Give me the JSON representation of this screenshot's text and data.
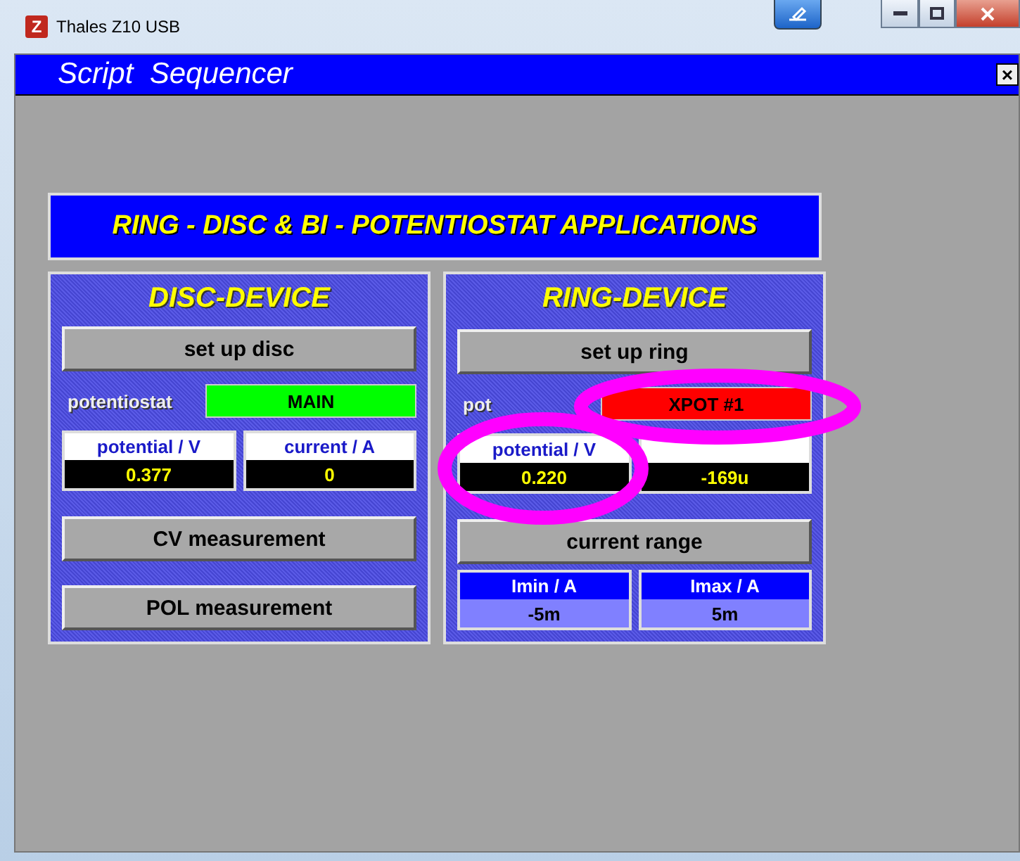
{
  "window": {
    "title": "Thales Z10 USB",
    "app_icon": "Z"
  },
  "dialog": {
    "title": "Script  Sequencer",
    "close": "×"
  },
  "banner": "RING - DISC & BI - POTENTIOSTAT APPLICATIONS",
  "panels": [
    {
      "title": "DISC-DEVICE",
      "setup_button": "set up disc",
      "potentiostat_label": "potentiostat",
      "potentiostat": {
        "value": "MAIN",
        "color": "#00ff00"
      },
      "readouts": [
        {
          "label": "potential / V",
          "value": "0.377"
        },
        {
          "label": "current / A",
          "value": "0"
        }
      ],
      "buttons": [
        {
          "kind": "button",
          "label": "CV measurement"
        },
        {
          "kind": "button",
          "label": "POL measurement"
        }
      ]
    },
    {
      "title": "RING-DEVICE",
      "setup_button": "set up ring",
      "potentiostat_label": "pot",
      "potentiostat": {
        "value": "XPOT #1",
        "color": "#ff0000"
      },
      "readouts": [
        {
          "label": "potential / V",
          "value": "0.220"
        },
        {
          "value": "-169u"
        }
      ],
      "buttons": [
        {
          "kind": "button",
          "label": "current range"
        },
        {
          "kind": "range",
          "fields": [
            {
              "label": "Imin / A",
              "value": "-5m"
            },
            {
              "label": "Imax / A",
              "value": "5m"
            }
          ]
        }
      ]
    }
  ],
  "highlights": [
    {
      "kind": "ellipse",
      "color": "#ff00ff"
    },
    {
      "kind": "ellipse",
      "color": "#ff00ff"
    }
  ]
}
